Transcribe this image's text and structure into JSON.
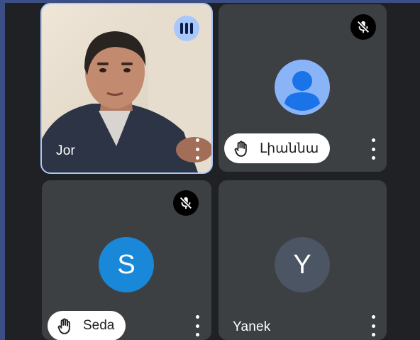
{
  "participants": [
    {
      "name": "Jor",
      "speaking": true,
      "has_video": true
    },
    {
      "name": "Լիաննա",
      "hand_raised": true,
      "muted": true,
      "avatar": "person-icon",
      "avatar_color": "#8ab4f8"
    },
    {
      "name": "Seda",
      "hand_raised": true,
      "muted": true,
      "avatar_letter": "S",
      "avatar_color": "#1a88d8"
    },
    {
      "name": "Yanek",
      "avatar_letter": "Y",
      "avatar_color": "#4b5563"
    }
  ],
  "colors": {
    "background": "#202124",
    "tile": "#3c4043",
    "active_outline": "#a8c7fa",
    "frame": "#3b4f86"
  }
}
